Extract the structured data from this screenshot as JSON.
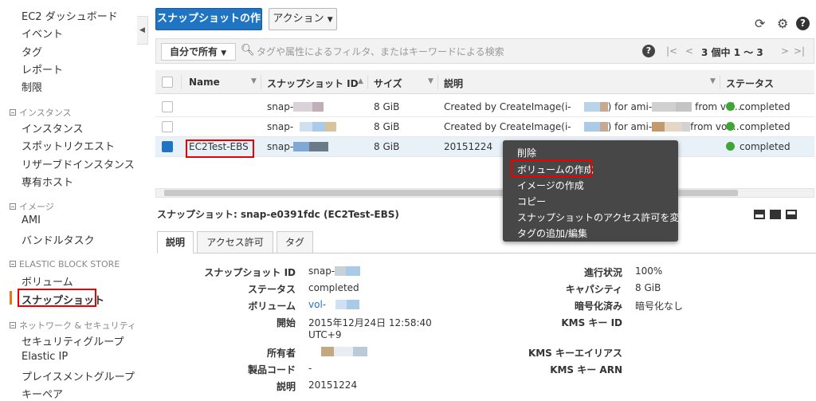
{
  "sidebar": {
    "items": [
      {
        "label": "EC2 ダッシュボード"
      },
      {
        "label": "イベント"
      },
      {
        "label": "タグ"
      },
      {
        "label": "レポート"
      },
      {
        "label": "制限"
      }
    ],
    "sections": [
      {
        "title": "インスタンス",
        "items": [
          "インスタンス",
          "スポットリクエスト",
          "リザーブドインスタンス",
          "専有ホスト"
        ]
      },
      {
        "title": "イメージ",
        "items": [
          "AMI",
          "バンドルタスク"
        ]
      },
      {
        "title": "ELASTIC BLOCK STORE",
        "items": [
          "ボリューム",
          "スナップショット"
        ]
      },
      {
        "title": "ネットワーク & セキュリティ",
        "items": [
          "セキュリティグループ",
          "Elastic IP",
          "プレイスメントグループ",
          "キーペア"
        ]
      }
    ],
    "active_item": "スナップショット"
  },
  "toolbar": {
    "create_label": "スナップショットの作成",
    "action_label": "アクション",
    "icons": [
      "refresh-icon",
      "gear-icon",
      "help-icon"
    ]
  },
  "filter": {
    "owner_label": "自分で所有",
    "placeholder": "タグや属性によるフィルタ、またはキーワードによる検索",
    "pager_text": "3 個中 1 ～ 3"
  },
  "table": {
    "columns": [
      "Name",
      "スナップショット ID",
      "サイズ",
      "説明",
      "ステータス"
    ],
    "rows": [
      {
        "name": "",
        "id": "snap-",
        "size": "8 GiB",
        "desc_a": "Created by CreateImage(i-",
        "desc_b": ") for ami-",
        "desc_c": "from vol…",
        "status": "completed",
        "selected": false
      },
      {
        "name": "",
        "id": "snap-",
        "size": "8 GiB",
        "desc_a": "Created by CreateImage(i-",
        "desc_b": ") for ami-",
        "desc_c": "from vol…",
        "status": "completed",
        "selected": false
      },
      {
        "name": "EC2Test-EBS",
        "id": "snap-",
        "size": "8 GiB",
        "desc_a": "20151224",
        "desc_b": "",
        "desc_c": "",
        "status": "completed",
        "selected": true
      }
    ]
  },
  "context_menu": {
    "items": [
      "削除",
      "ボリュームの作成",
      "イメージの作成",
      "コピー",
      "スナップショットのアクセス許可を変更",
      "タグの追加/編集"
    ],
    "highlighted": "ボリュームの作成"
  },
  "detail": {
    "title": "スナップショット: snap-e0391fdc (EC2Test-EBS)",
    "tabs": [
      "説明",
      "アクセス許可",
      "タグ"
    ],
    "left": [
      {
        "label": "スナップショット ID",
        "value": "snap-"
      },
      {
        "label": "ステータス",
        "value": "completed"
      },
      {
        "label": "ボリューム",
        "value": "vol-"
      },
      {
        "label": "開始",
        "value": "2015年12月24日 12:58:40",
        "value2": "UTC+9"
      },
      {
        "label": "所有者",
        "value": ""
      },
      {
        "label": "製品コード",
        "value": "-"
      },
      {
        "label": "説明",
        "value": "20151224"
      }
    ],
    "right": [
      {
        "label": "進行状況",
        "value": "100%"
      },
      {
        "label": "キャパシティ",
        "value": "8 GiB"
      },
      {
        "label": "暗号化済み",
        "value": "暗号化なし"
      },
      {
        "label": "KMS キー ID",
        "value": ""
      },
      {
        "label": "KMS キーエイリアス",
        "value": ""
      },
      {
        "label": "KMS キー ARN",
        "value": ""
      }
    ]
  },
  "colors": {
    "primary": "#1f74c3",
    "status_ok": "#3fa535",
    "highlight": "#e00000",
    "menu_bg": "#474747"
  }
}
